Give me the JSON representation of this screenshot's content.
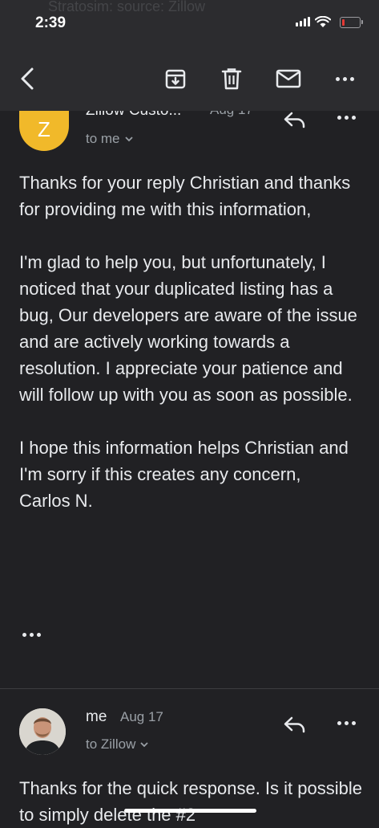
{
  "status": {
    "time": "2:39",
    "ghost_text": "Stratosim: source: Zillow"
  },
  "toolbar": {
    "back": "back",
    "archive": "archive-icon",
    "delete": "trash-icon",
    "mark": "mail-icon",
    "more": "more-icon"
  },
  "message1": {
    "avatar_letter": "Z",
    "sender": "Zillow Custo...",
    "date": "Aug 17",
    "to": "to me",
    "paragraphs": [
      "Thanks for your reply Christian and thanks for providing me with this information,",
      "I'm glad to help you, but unfortunately, I noticed that your duplicated listing has a bug, Our developers are aware of the issue and are actively working towards a resolution. I appreciate your patience and will follow up with you as soon as possible.",
      "I hope this information helps Christian and I'm sorry if this creates any concern,"
    ],
    "signature": "Carlos N."
  },
  "message2": {
    "sender": "me",
    "date": "Aug 17",
    "to": "to Zillow",
    "preview": "Thanks for the quick response. Is it possible to simply delete the #2"
  },
  "colors": {
    "background": "#212124",
    "toolbar": "#2c2c2f",
    "avatar": "#f1b92a",
    "text": "#e8eaed",
    "muted": "#9aa0a6",
    "battery_low": "#e53935"
  }
}
